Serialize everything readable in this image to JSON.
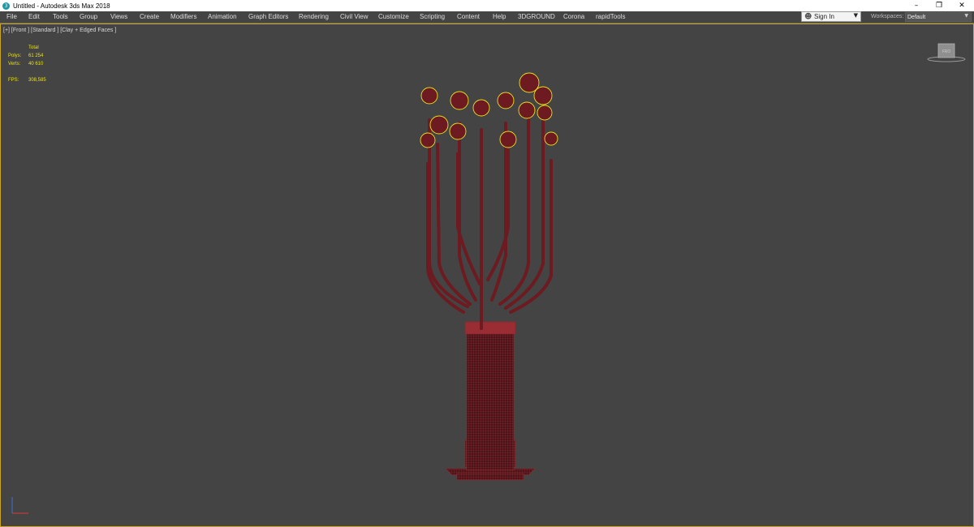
{
  "titlebar": {
    "title": "Untitled - Autodesk 3ds Max 2018",
    "app_icon_glyph": "3",
    "minimize_glyph": "–",
    "restore_glyph": "❐",
    "close_glyph": "✕"
  },
  "menu": {
    "items": [
      "File",
      "Edit",
      "Tools",
      "Group",
      "Views",
      "Create",
      "Modifiers",
      "Animation",
      "Graph Editors",
      "Rendering",
      "Civil View",
      "Customize",
      "Scripting",
      "Content",
      "Help",
      "3DGROUND",
      "Corona",
      "rapidTools"
    ]
  },
  "signin": {
    "label": "Sign In",
    "icon": "person-icon",
    "caret": "▼"
  },
  "workspaces": {
    "label": "Workspaces:",
    "value": "Default",
    "caret": "▼"
  },
  "viewport": {
    "label": "[+] [Front ] [Standard ] [Clay + Edged Faces ]",
    "stats": {
      "header": "Total",
      "polys_label": "Polys:",
      "polys_value": "61 254",
      "verts_label": "Verts:",
      "verts_value": "40 610",
      "fps_label": "FPS:",
      "fps_value": "308,585"
    },
    "viewcube_label": "FRO"
  },
  "colors": {
    "viewport_bg": "#444444",
    "active_border": "#c9a521",
    "stats_text": "#e7e020",
    "wire_red": "#7a1e24",
    "selection_yellow": "#e8e21a"
  }
}
